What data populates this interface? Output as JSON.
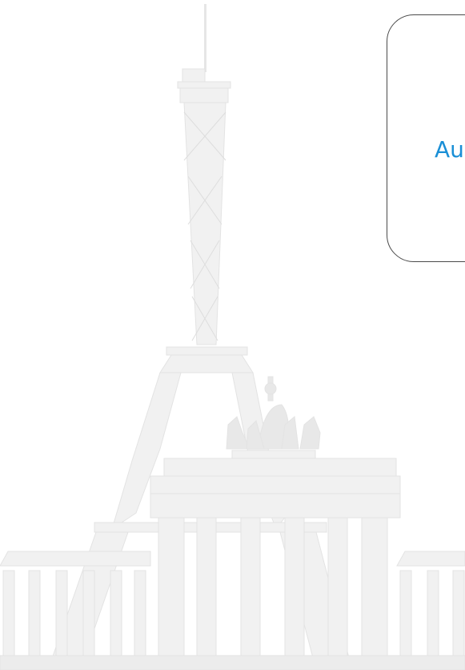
{
  "card": {
    "label": "Au"
  },
  "illustration": {
    "name": "eiffel-tower-and-brandenburg-gate-skyline",
    "fill_color": "#f0f0f0",
    "stroke_color": "#e2e2e2"
  },
  "colors": {
    "background": "#ffffff",
    "card_border": "#4a4a4a",
    "accent_text": "#1a8fd6"
  }
}
